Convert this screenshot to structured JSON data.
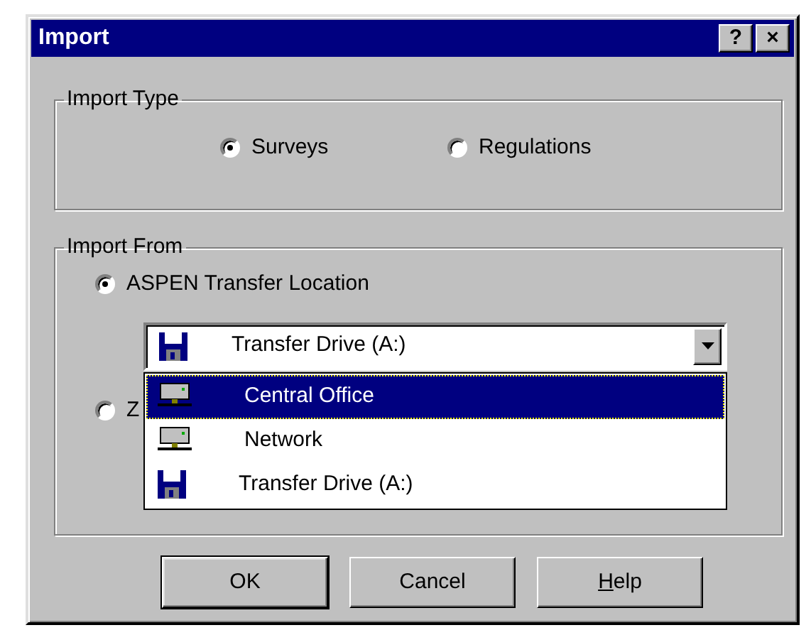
{
  "window": {
    "title": "Import",
    "title_buttons": [
      "?",
      "×"
    ]
  },
  "import_type": {
    "label": "Import Type",
    "options": [
      {
        "label": "Surveys",
        "selected": true
      },
      {
        "label": "Regulations",
        "selected": false
      }
    ]
  },
  "import_from": {
    "label": "Import From",
    "options": [
      {
        "label": "ASPEN Transfer Location",
        "selected": true
      },
      {
        "label": "Z",
        "selected": false
      }
    ],
    "location": {
      "value": "Transfer Drive (A:)",
      "kind": "floppy",
      "open": true,
      "items": [
        {
          "label": "Central Office",
          "kind": "computer",
          "highlighted": true
        },
        {
          "label": "Network",
          "kind": "computer",
          "highlighted": false
        },
        {
          "label": "Transfer Drive (A:)",
          "kind": "floppy",
          "highlighted": false
        }
      ]
    }
  },
  "buttons": [
    {
      "label": "OK",
      "default": true
    },
    {
      "label": "Cancel",
      "default": false
    },
    {
      "label": "Help",
      "default": false,
      "first_letter_underlined": true
    }
  ]
}
